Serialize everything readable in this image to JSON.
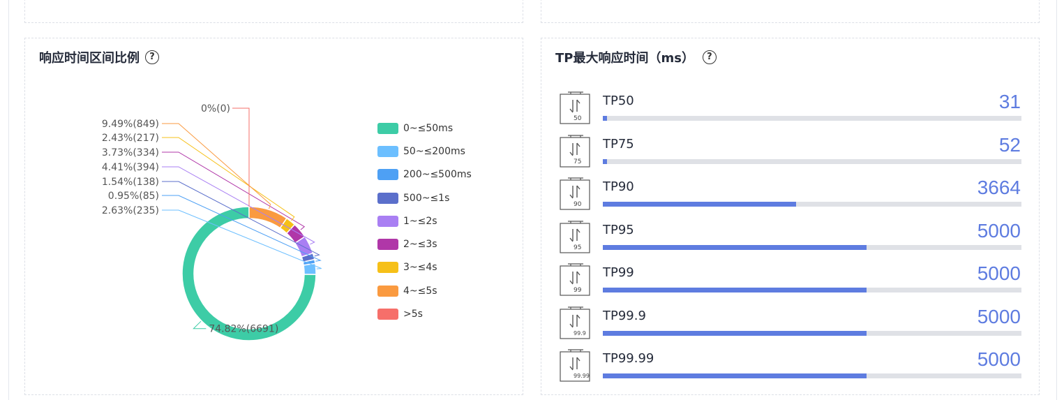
{
  "left_card": {
    "title": "响应时间区间比例",
    "help": "?"
  },
  "right_card": {
    "title": "TP最大响应时间（ms）",
    "help": "?"
  },
  "chart_data": {
    "type": "pie",
    "donut": true,
    "legend_position": "right",
    "max_value": 5000,
    "slices": [
      {
        "name": "0~≤50ms",
        "label": "74.82%(6691)",
        "percent": 74.82,
        "count": 6691,
        "color": "#3dcca6"
      },
      {
        "name": "50~≤200ms",
        "label": "2.63%(235)",
        "percent": 2.63,
        "count": 235,
        "color": "#6cbfff"
      },
      {
        "name": "200~≤500ms",
        "label": "0.95%(85)",
        "percent": 0.95,
        "count": 85,
        "color": "#4ea0f4"
      },
      {
        "name": "500~≤1s",
        "label": "1.54%(138)",
        "percent": 1.54,
        "count": 138,
        "color": "#5b6fcb"
      },
      {
        "name": "1~≤2s",
        "label": "4.41%(394)",
        "percent": 4.41,
        "count": 394,
        "color": "#a97ff3"
      },
      {
        "name": "2~≤3s",
        "label": "3.73%(334)",
        "percent": 3.73,
        "count": 334,
        "color": "#b037a8"
      },
      {
        "name": "3~≤4s",
        "label": "2.43%(217)",
        "percent": 2.43,
        "count": 217,
        "color": "#f6c018"
      },
      {
        "name": "4~≤5s",
        "label": "9.49%(849)",
        "percent": 9.49,
        "count": 849,
        "color": "#fa9a40"
      },
      {
        "name": ">5s",
        "label": "0%(0)",
        "percent": 0,
        "count": 0,
        "color": "#f66f6a"
      }
    ]
  },
  "tp_list": [
    {
      "name": "TP50",
      "icon_label": "50",
      "value": "31",
      "num": 31
    },
    {
      "name": "TP75",
      "icon_label": "75",
      "value": "52",
      "num": 52
    },
    {
      "name": "TP90",
      "icon_label": "90",
      "value": "3664",
      "num": 3664
    },
    {
      "name": "TP95",
      "icon_label": "95",
      "value": "5000",
      "num": 5000
    },
    {
      "name": "TP99",
      "icon_label": "99",
      "value": "5000",
      "num": 5000
    },
    {
      "name": "TP99.9",
      "icon_label": "99.9",
      "value": "5000",
      "num": 5000
    },
    {
      "name": "TP99.99",
      "icon_label": "99.99",
      "value": "5000",
      "num": 5000
    }
  ],
  "colors": {
    "accent": "#5e7ce0",
    "track": "#dfe1e6"
  }
}
